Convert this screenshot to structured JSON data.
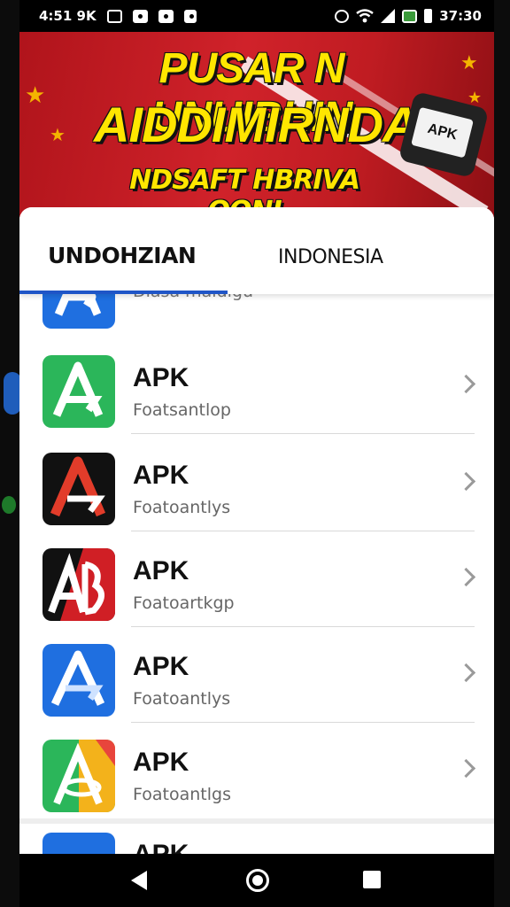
{
  "status_bar": {
    "left_text": "4:51 9K",
    "time": "37:30",
    "icons": [
      "image-icon",
      "shield-icon",
      "camera-icon",
      "bag-icon",
      "alarm-icon",
      "wifi-icon",
      "signal-icon",
      "sim-icon",
      "battery-icon"
    ]
  },
  "banner": {
    "line1": "PUSAR N UNUIBHIN",
    "line2": "AIDDIMIRNDAIA",
    "line3": "NDSAFT HBRIVA OONI",
    "apk_tag": "APK",
    "colors": {
      "background": "#c8201f",
      "headline": "#ffe600"
    }
  },
  "tabs": [
    {
      "label": "UNDOHZIAN",
      "active": true
    },
    {
      "label": "INDONESIA",
      "active": false
    }
  ],
  "list": {
    "partial_top": {
      "subtitle": "Dlasa maldigu"
    },
    "items": [
      {
        "title": "APK",
        "subtitle": "Foatsantlop",
        "icon": "green-apk-icon"
      },
      {
        "title": "APK",
        "subtitle": "Foatoantlys",
        "icon": "red-black-apk-icon"
      },
      {
        "title": "APK",
        "subtitle": "Foatoartkgp",
        "icon": "red-ab-apk-icon"
      },
      {
        "title": "APK",
        "subtitle": "Foatoantlys",
        "icon": "blue-apk-icon"
      },
      {
        "title": "APK",
        "subtitle": "Foatoantlgs",
        "icon": "colorful-apk-icon"
      }
    ],
    "partial_bottom": {
      "title": "APK"
    }
  },
  "nav": {
    "icons": [
      "back-icon",
      "home-icon",
      "recent-apps-icon"
    ]
  },
  "colors": {
    "accent": "#1f55c7"
  }
}
